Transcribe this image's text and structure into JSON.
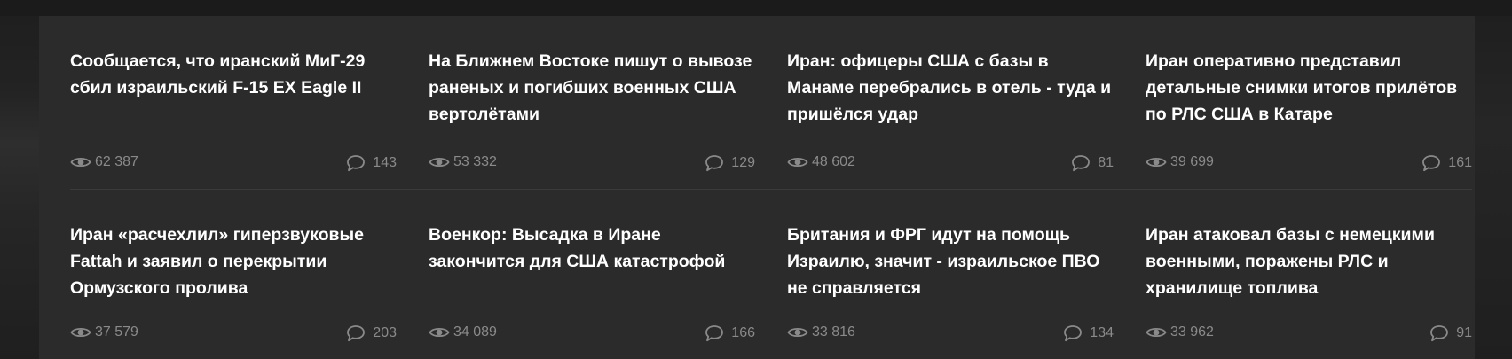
{
  "colors": {
    "panel_bg": "#2b2b2b",
    "page_bg": "#1a1a1a",
    "title": "#ffffff",
    "meta": "#8a8a8a"
  },
  "articles": [
    {
      "title": "Сообщается, что иранский МиГ-29 сбил израильский F-15 EX Eagle II",
      "views": "62 387",
      "comments": "143"
    },
    {
      "title": "На Ближнем Востоке пишут о вывозе раненых и погибших военных США вертолётами",
      "views": "53 332",
      "comments": "129"
    },
    {
      "title": "Иран: офицеры США с базы в Манаме перебрались в отель - туда и пришёлся удар",
      "views": "48 602",
      "comments": "81"
    },
    {
      "title": "Иран оперативно представил детальные снимки итогов прилётов по РЛС США в Катаре",
      "views": "39 699",
      "comments": "161"
    },
    {
      "title": "Иран «расчехлил» гиперзвуковые Fattah и заявил о перекрытии Ормузского пролива",
      "views": "37 579",
      "comments": "203"
    },
    {
      "title": "Военкор: Высадка в Иране закончится для США катастрофой",
      "views": "34 089",
      "comments": "166"
    },
    {
      "title": "Британия и ФРГ идут на помощь Израилю, значит - израильское ПВО не справляется",
      "views": "33 816",
      "comments": "134"
    },
    {
      "title": "Иран атаковал базы с немецкими военными, поражены РЛС и хранилище топлива",
      "views": "33 962",
      "comments": "91"
    }
  ]
}
